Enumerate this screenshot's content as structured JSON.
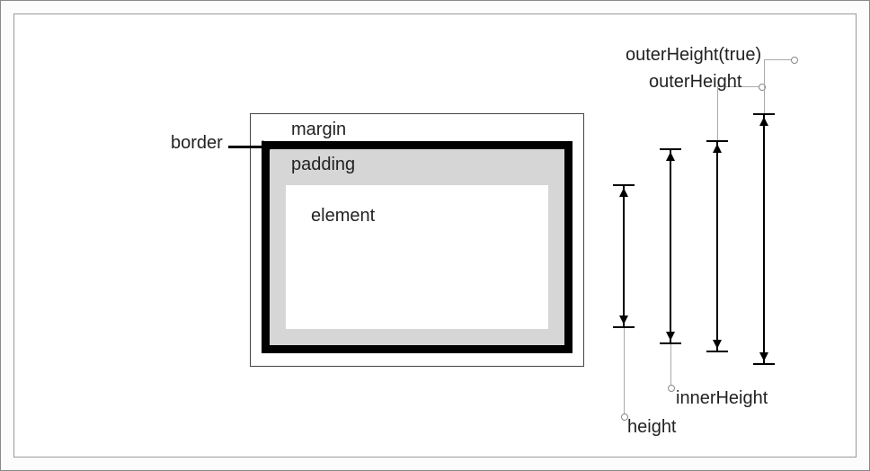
{
  "labels": {
    "margin": "margin",
    "border": "border",
    "padding": "padding",
    "element": "element"
  },
  "measurements": {
    "height": "height",
    "innerHeight": "innerHeight",
    "outerHeight": "outerHeight",
    "outerHeightTrue": "outerHeight(true)"
  }
}
